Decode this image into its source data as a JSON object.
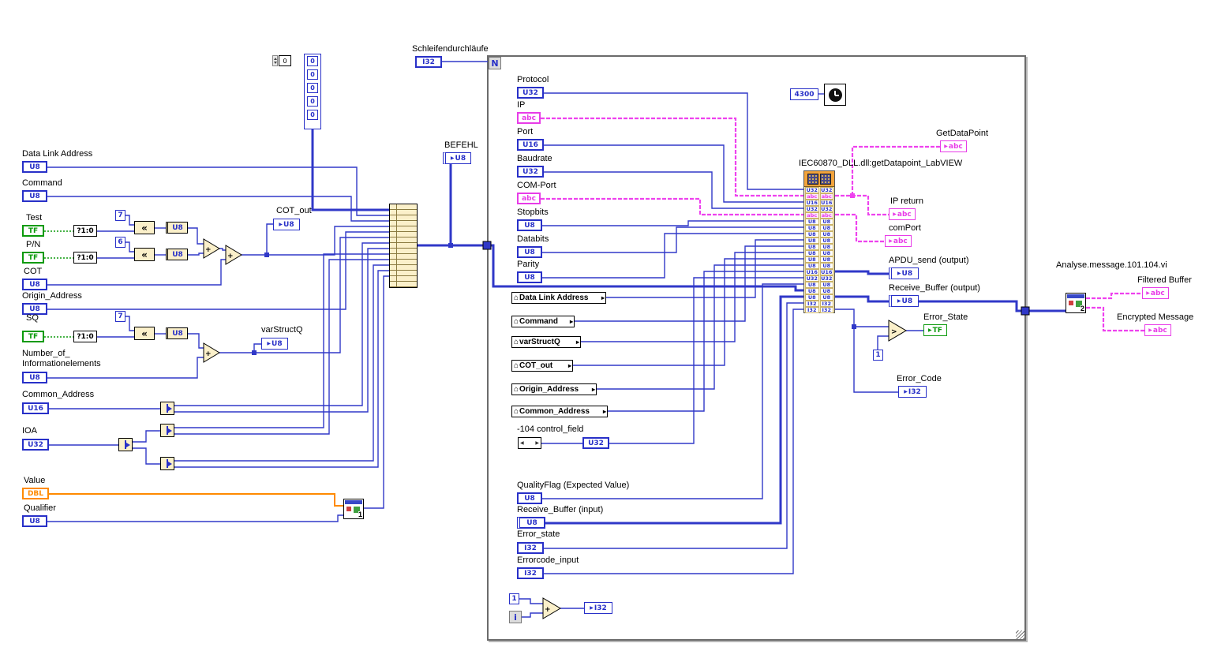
{
  "top": {
    "array_index": "0",
    "array_values": [
      "0",
      "0",
      "0",
      "0",
      "0"
    ],
    "loop_count_label": "Schleifendurchläufe",
    "loop_count_type": "I32",
    "loop_n": "N",
    "loop_i": "i"
  },
  "left_inputs": [
    {
      "label": "Data Link Address",
      "type": "U8"
    },
    {
      "label": "Command",
      "type": "U8"
    },
    {
      "label": "Test",
      "type": "TF"
    },
    {
      "label": "P/N",
      "type": "TF"
    },
    {
      "label": "COT",
      "type": "U8"
    },
    {
      "label": "Origin_Address",
      "type": "U8"
    },
    {
      "label": "SQ",
      "type": "TF"
    },
    {
      "label": "Number_of_",
      "label2": "Informationelements",
      "type": "U8"
    },
    {
      "label": "Common_Address",
      "type": "U16"
    },
    {
      "label": "IOA",
      "type": "U32"
    },
    {
      "label": "Value",
      "type": "DBL"
    },
    {
      "label": "Qualifier",
      "type": "U8"
    }
  ],
  "left_nodes": {
    "select": "?1:0",
    "const_test": "7",
    "const_pn": "6",
    "const_sq": "7",
    "shift_icon": "«",
    "to_u8": "U8",
    "subvi_index": "1"
  },
  "mid": {
    "cot_out_label": "COT_out",
    "cot_out_type": "U8",
    "varstructq_label": "varStructQ",
    "varstructq_type": "U8",
    "befehl_label": "BEFEHL",
    "befehl_type": "U8"
  },
  "loop_inputs": [
    {
      "label": "Protocol",
      "type": "U32"
    },
    {
      "label": "IP",
      "type": "abc"
    },
    {
      "label": "Port",
      "type": "U16"
    },
    {
      "label": "Baudrate",
      "type": "U32"
    },
    {
      "label": "COM-Port",
      "type": "abc"
    },
    {
      "label": "Stopbits",
      "type": "U8"
    },
    {
      "label": "Databits",
      "type": "U8"
    },
    {
      "label": "Parity",
      "type": "U8"
    }
  ],
  "locals": [
    {
      "label": "Data Link Address"
    },
    {
      "label": "Command"
    },
    {
      "label": "varStructQ"
    },
    {
      "label": "COT_out"
    },
    {
      "label": "Origin_Address"
    },
    {
      "label": "Common_Address"
    }
  ],
  "control_field": {
    "label": "-104 control_field",
    "type": "U32"
  },
  "lower_inputs": [
    {
      "label": "QualityFlag (Expected Value)",
      "type": "U8"
    },
    {
      "label": "Receive_Buffer (input)",
      "type": "U8"
    },
    {
      "label": "Error_state",
      "type": "I32"
    },
    {
      "label": "Errorcode_input",
      "type": "I32"
    }
  ],
  "dll": {
    "label": "IEC60870_DLL.dll:getDatapoint_LabVIEW",
    "rows": [
      [
        "U32",
        "U32"
      ],
      [
        "abc",
        "abc"
      ],
      [
        "U16",
        "U16"
      ],
      [
        "U32",
        "U32"
      ],
      [
        "abc",
        "abc"
      ],
      [
        "U8",
        "U8"
      ],
      [
        "U8",
        "U8"
      ],
      [
        "U8",
        "U8"
      ],
      [
        "U8",
        "U8"
      ],
      [
        "U8",
        "U8"
      ],
      [
        "U8",
        "U8"
      ],
      [
        "U8",
        "U8"
      ],
      [
        "U8",
        "U8"
      ],
      [
        "U16",
        "U16"
      ],
      [
        "U32",
        "U32"
      ],
      [
        "U8",
        "U8"
      ],
      [
        "U8",
        "U8"
      ],
      [
        "U8",
        "U8"
      ],
      [
        "I32",
        "I32"
      ],
      [
        "I32",
        "I32"
      ]
    ]
  },
  "timer": "4300",
  "outputs": {
    "getdatapoint": {
      "label": "GetDataPoint",
      "type": "abc"
    },
    "ip_return": {
      "label": "IP return",
      "type": "abc"
    },
    "comport": {
      "label": "comPort",
      "type": "abc"
    },
    "apdu": {
      "label": "APDU_send (output)",
      "type": "U8"
    },
    "receive_buffer": {
      "label": "Receive_Buffer (output)",
      "type": "U8"
    },
    "error_state": {
      "label": "Error_State",
      "type": "TF"
    },
    "error_code": {
      "label": "Error_Code",
      "type": "I32"
    },
    "error_const": "1"
  },
  "increment": {
    "const": "1",
    "result_type": "I32"
  },
  "icons": {
    "plus": "+",
    "gt": ">"
  },
  "analyse": {
    "label": "Analyse.message.101.104.vi",
    "index": "2",
    "filtered": {
      "label": "Filtered Buffer",
      "type": "abc"
    },
    "encrypted": {
      "label": "Encrypted Message",
      "type": "abc"
    }
  }
}
